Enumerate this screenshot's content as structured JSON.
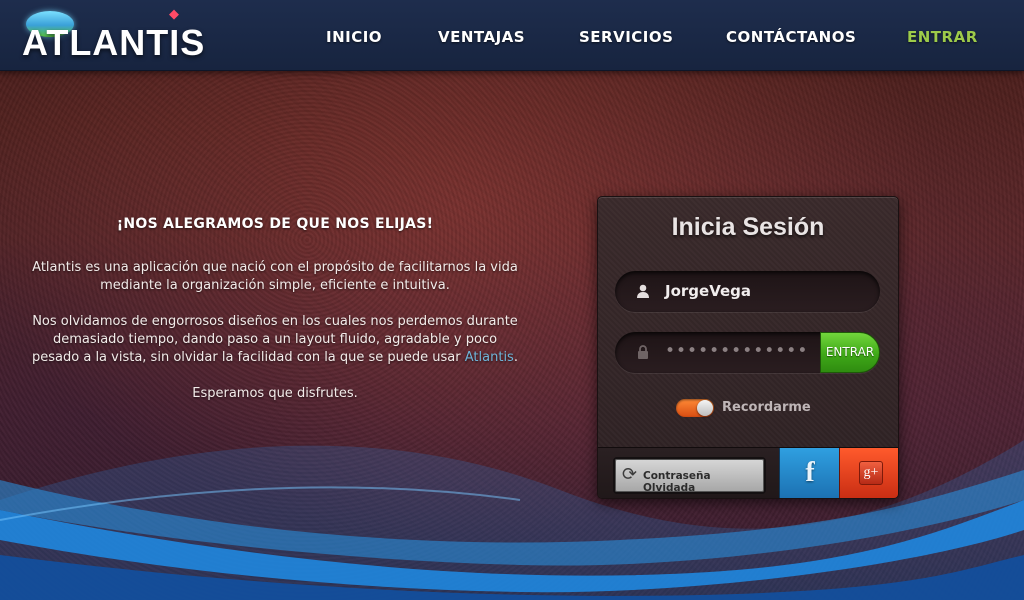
{
  "brand": {
    "name": "ATLANTIS"
  },
  "nav": [
    {
      "label": "INICIO",
      "active": false
    },
    {
      "label": "VENTAJAS",
      "active": false
    },
    {
      "label": "SERVICIOS",
      "active": false
    },
    {
      "label": "CONTÁCTANOS",
      "active": false
    },
    {
      "label": "ENTRAR",
      "active": true
    }
  ],
  "intro": {
    "heading": "¡NOS ALEGRAMOS DE QUE NOS ELIJAS!",
    "p1": "Atlantis es una aplicación que nació con el propósito de facilitarnos la vida mediante la organización simple, eficiente e intuitiva.",
    "p2_before": "Nos olvidamos de engorrosos diseños en los cuales nos perdemos durante demasiado tiempo, dando paso a un layout fluido, agradable y poco pesado a la vista, sin olvidar la facilidad con la que se puede usar ",
    "p2_link": "Atlantis",
    "p2_after": ".",
    "p3": "Esperamos que disfrutes."
  },
  "login": {
    "title": "Inicia Sesión",
    "username_value": "JorgeVega",
    "password_mask": "•••••••••••••",
    "submit_label": "ENTRAR",
    "remember_label": "Recordarme",
    "remember_on": true,
    "forgot_label": "Contraseña Olvidada",
    "facebook_glyph": "f",
    "google_glyph": "g+"
  },
  "colors": {
    "header_bg": "#1e2d4d",
    "nav_active": "#9dcb4a",
    "link": "#6fb4d8",
    "submit_green": "#3fa818",
    "facebook_blue": "#1b6fb0",
    "google_red": "#c62b12",
    "toggle_orange": "#d84d12"
  },
  "icons": {
    "user": "user-icon",
    "lock": "lock-icon",
    "refresh": "refresh-icon",
    "gem": "gem-icon"
  }
}
